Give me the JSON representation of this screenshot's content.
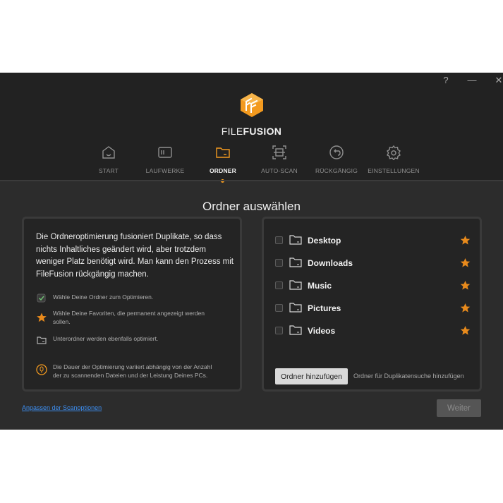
{
  "window": {
    "help_label": "?",
    "minimize_label": "—",
    "close_label": "✕"
  },
  "brand": {
    "part1": "FILE",
    "part2": "FUSION"
  },
  "tabs": [
    {
      "label": "START",
      "icon": "home-icon"
    },
    {
      "label": "LAUFWERKE",
      "icon": "drive-icon"
    },
    {
      "label": "ORDNER",
      "icon": "folder-icon",
      "active": true
    },
    {
      "label": "AUTO-SCAN",
      "icon": "scan-icon"
    },
    {
      "label": "RÜCKGÄNGIG",
      "icon": "undo-icon"
    },
    {
      "label": "EINSTELLUNGEN",
      "icon": "gear-icon"
    }
  ],
  "page_title": "Ordner auswählen",
  "left_panel": {
    "intro": "Die Ordneroptimierung fusioniert Duplikate, so dass nichts Inhaltliches geändert wird, aber trotzdem weniger Platz benötigt wird. Man kann den Prozess mit FileFusion rückgängig machen.",
    "info": [
      {
        "icon": "checkbox-checked-icon",
        "text": "Wähle Deine Ordner zum Optimieren."
      },
      {
        "icon": "star-icon",
        "text": "Wähle Deine Favoriten, die permanent angezeigt werden sollen."
      },
      {
        "icon": "subfolder-icon",
        "text": "Unterordner werden ebenfalls optimiert."
      },
      {
        "icon": "info-circle-icon",
        "text": "Die Dauer der Optimierung variiert abhängig von der Anzahl der zu scannenden Dateien und der Leistung Deines PCs."
      }
    ]
  },
  "folders": [
    {
      "name": "Desktop",
      "favorite": true
    },
    {
      "name": "Downloads",
      "favorite": true
    },
    {
      "name": "Music",
      "favorite": true
    },
    {
      "name": "Pictures",
      "favorite": true
    },
    {
      "name": "Videos",
      "favorite": true
    }
  ],
  "add_button_label": "Ordner hinzufügen",
  "add_hint": "Ordner für Duplikatensuche hinzufügen",
  "scan_link": "Anpassen der Scanoptionen",
  "next_button_label": "Weiter",
  "colors": {
    "accent": "#f39a1f",
    "link": "#3d8ef0",
    "background": "#2c2c2c",
    "header": "#222222"
  }
}
